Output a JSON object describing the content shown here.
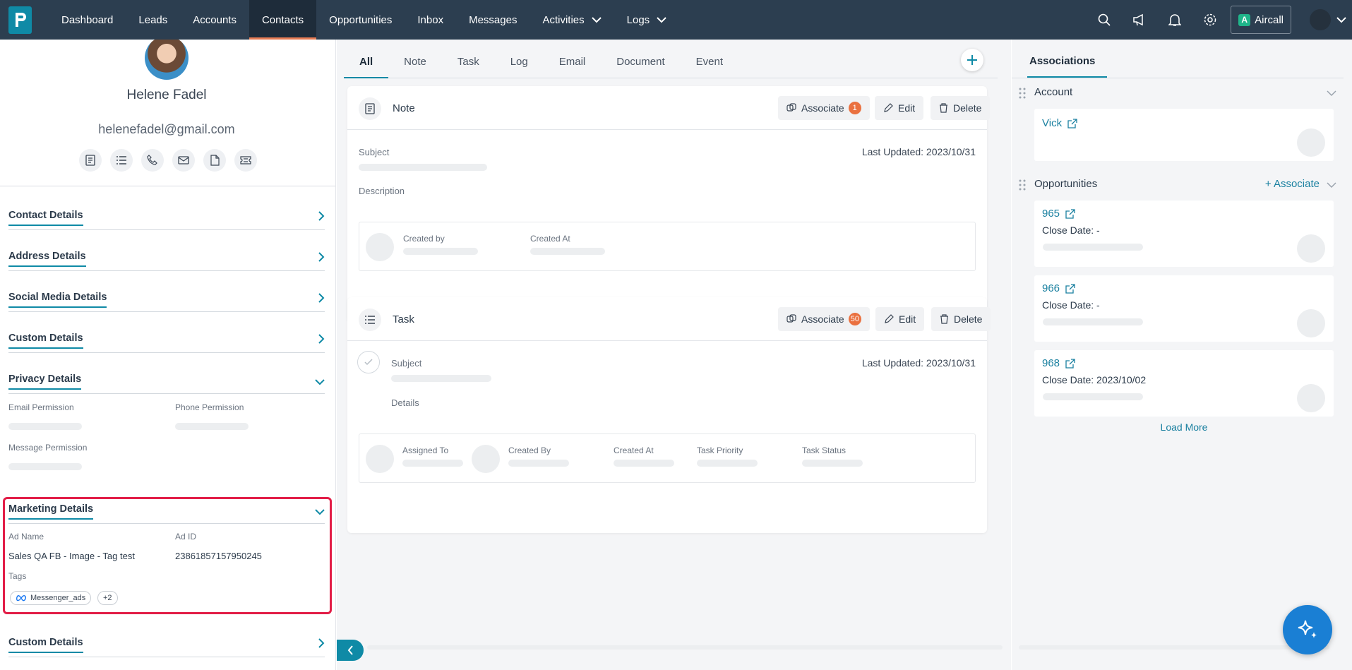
{
  "nav": {
    "items": [
      "Dashboard",
      "Leads",
      "Accounts",
      "Contacts",
      "Opportunities",
      "Inbox",
      "Messages",
      "Activities",
      "Logs"
    ],
    "active": "Contacts",
    "aircall": "Aircall",
    "accent": "#e67c54"
  },
  "profile": {
    "name": "Helene Fadel",
    "email": "helenefadel@gmail.com"
  },
  "sections": {
    "contact": "Contact Details",
    "address": "Address Details",
    "social": "Social Media Details",
    "custom": "Custom Details",
    "privacy": "Privacy Details",
    "marketing": "Marketing Details",
    "custom2": "Custom Details"
  },
  "privacy": {
    "email_perm": "Email Permission",
    "phone_perm": "Phone Permission",
    "message_perm": "Message Permission"
  },
  "marketing": {
    "ad_name_label": "Ad Name",
    "ad_name": "Sales QA FB - Image - Tag test",
    "ad_id_label": "Ad ID",
    "ad_id": "23861857157950245",
    "tags_label": "Tags",
    "tag": "Messenger_ads",
    "more_tags": "+2"
  },
  "timeline": {
    "tabs": [
      "All",
      "Note",
      "Task",
      "Log",
      "Email",
      "Document",
      "Event"
    ],
    "active_tab": "All",
    "note": {
      "title": "Note",
      "associate": "Associate",
      "associate_count": "1",
      "edit": "Edit",
      "delete": "Delete",
      "subject": "Subject",
      "last_updated": "Last Updated: 2023/10/31",
      "description": "Description",
      "created_by": "Created by",
      "created_at": "Created At"
    },
    "task": {
      "title": "Task",
      "associate": "Associate",
      "associate_count": "50",
      "edit": "Edit",
      "delete": "Delete",
      "subject": "Subject",
      "last_updated": "Last Updated: 2023/10/31",
      "details": "Details",
      "assigned_to": "Assigned To",
      "created_by": "Created By",
      "created_at": "Created At",
      "priority": "Task Priority",
      "status": "Task Status"
    }
  },
  "associations": {
    "tab": "Associations",
    "account_header": "Account",
    "account_name": "Vick",
    "opps_header": "Opportunities",
    "associate_link": "+ Associate",
    "opps": [
      {
        "id": "965",
        "close_label": "Close Date:",
        "close": "-"
      },
      {
        "id": "966",
        "close_label": "Close Date:",
        "close": "-"
      },
      {
        "id": "968",
        "close_label": "Close Date:",
        "close": "2023/10/02"
      }
    ],
    "load_more": "Load More"
  }
}
